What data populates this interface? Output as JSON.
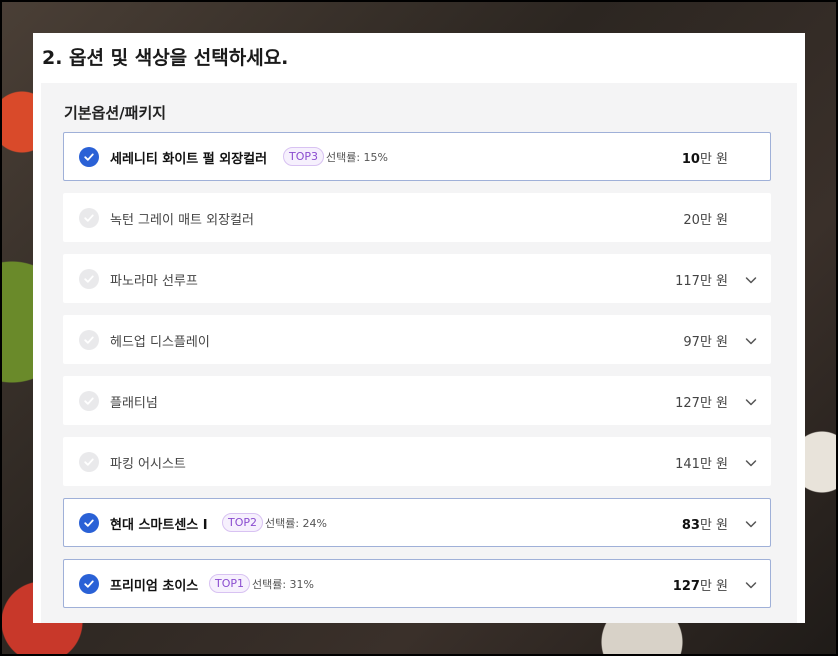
{
  "panel": {
    "title": "2. 옵션 및 색상을 선택하세요.",
    "section_label": "기본옵션/패키지"
  },
  "options": [
    {
      "name": "세레니티 화이트 펄 외장컬러",
      "selected": true,
      "badge": "TOP3",
      "rate": "선택률: 15%",
      "price_num": "10",
      "price_unit": "만 원",
      "has_chevron": false
    },
    {
      "name": "녹턴 그레이 매트 외장컬러",
      "selected": false,
      "badge": "",
      "rate": "",
      "price_num": "20",
      "price_unit": "만 원",
      "has_chevron": false
    },
    {
      "name": "파노라마 선루프",
      "selected": false,
      "badge": "",
      "rate": "",
      "price_num": "117",
      "price_unit": "만 원",
      "has_chevron": true
    },
    {
      "name": "헤드업 디스플레이",
      "selected": false,
      "badge": "",
      "rate": "",
      "price_num": "97",
      "price_unit": "만 원",
      "has_chevron": true
    },
    {
      "name": "플래티넘",
      "selected": false,
      "badge": "",
      "rate": "",
      "price_num": "127",
      "price_unit": "만 원",
      "has_chevron": true
    },
    {
      "name": "파킹 어시스트",
      "selected": false,
      "badge": "",
      "rate": "",
      "price_num": "141",
      "price_unit": "만 원",
      "has_chevron": true
    },
    {
      "name": "현대 스마트센스 I",
      "selected": true,
      "badge": "TOP2",
      "rate": "선택률: 24%",
      "price_num": "83",
      "price_unit": "만 원",
      "has_chevron": true
    },
    {
      "name": "프리미엄 초이스",
      "selected": true,
      "badge": "TOP1",
      "rate": "선택률: 31%",
      "price_num": "127",
      "price_unit": "만 원",
      "has_chevron": true
    }
  ],
  "icons": {
    "check": "check-icon",
    "chevron": "chevron-down-icon"
  },
  "colors": {
    "selected_check": "#2a61d6",
    "selected_border": "#9fb0d8",
    "badge_text": "#8a4ccf"
  }
}
